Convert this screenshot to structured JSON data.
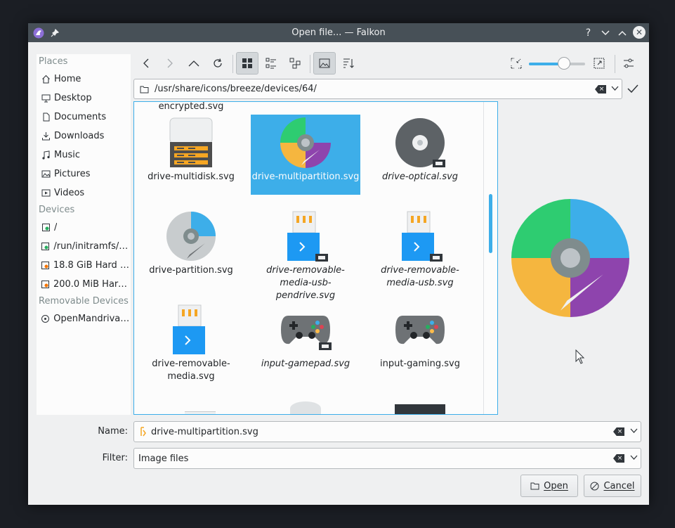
{
  "window": {
    "title": "Open file... — Falkon"
  },
  "places": {
    "header_places": "Places",
    "items_places": [
      {
        "label": "Home",
        "icon": "home-icon"
      },
      {
        "label": "Desktop",
        "icon": "desktop-icon"
      },
      {
        "label": "Documents",
        "icon": "documents-icon"
      },
      {
        "label": "Downloads",
        "icon": "download-icon"
      },
      {
        "label": "Music",
        "icon": "music-icon"
      },
      {
        "label": "Pictures",
        "icon": "pictures-icon"
      },
      {
        "label": "Videos",
        "icon": "videos-icon"
      }
    ],
    "header_devices": "Devices",
    "items_devices": [
      {
        "label": "/",
        "icon": "drive-icon"
      },
      {
        "label": "/run/initramfs/u...",
        "icon": "drive-icon"
      },
      {
        "label": "18.8 GiB Hard D...",
        "icon": "hard-drive-icon"
      },
      {
        "label": "200.0 MiB Hard ...",
        "icon": "hard-drive-icon"
      }
    ],
    "header_removable": "Removable Devices",
    "items_removable": [
      {
        "label": "OpenMandrivaL...",
        "icon": "removable-drive-icon"
      }
    ]
  },
  "location": {
    "path": "/usr/share/icons/breeze/devices/64/"
  },
  "files": {
    "partial_top": "encrypted.svg",
    "items": [
      {
        "name": "drive-multidisk.svg",
        "italic": false
      },
      {
        "name": "drive-multipartition.svg",
        "italic": false,
        "selected": true
      },
      {
        "name": "drive-optical.svg",
        "italic": true
      },
      {
        "name": "drive-partition.svg",
        "italic": false
      },
      {
        "name": "drive-removable-media-usb-pendrive.svg",
        "italic": true
      },
      {
        "name": "drive-removable-media-usb.svg",
        "italic": true
      },
      {
        "name": "drive-removable-media.svg",
        "italic": false
      },
      {
        "name": "input-gamepad.svg",
        "italic": true
      },
      {
        "name": "input-gaming.svg",
        "italic": false
      }
    ]
  },
  "zoom": {
    "level": 0.62
  },
  "name_row": {
    "label": "Name:",
    "value": "drive-multipartition.svg"
  },
  "filter_row": {
    "label": "Filter:",
    "value": "Image files"
  },
  "buttons": {
    "open": "Open",
    "cancel": "Cancel"
  },
  "colors": {
    "accent": "#3daee9",
    "titlebar": "#475057"
  }
}
